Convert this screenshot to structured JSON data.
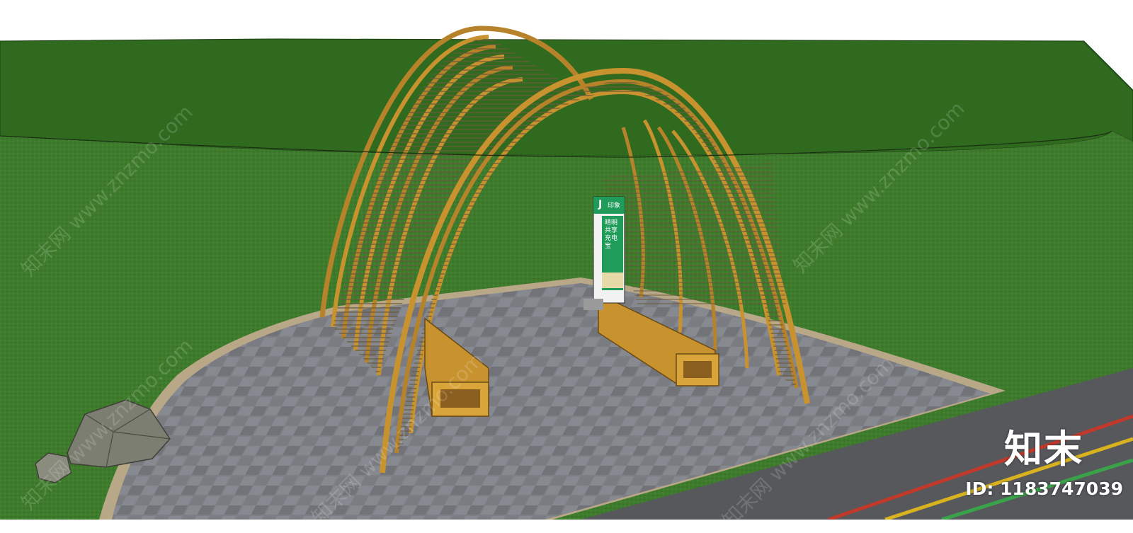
{
  "watermark": {
    "brand": "知末",
    "id_text": "ID: 1183747039",
    "site_text": "知末网 www.znzmo.com"
  },
  "sign": {
    "logo": "J",
    "header": "印象",
    "slogan": "晴明共享充电宝"
  },
  "colors": {
    "sky": "#ffffff",
    "grass": "#3f7d2e",
    "hill": "#2f6a1f",
    "pavement": "#7d7f84",
    "bamboo": "#c8922e",
    "road": "#57595d",
    "sign_green": "#1f9b5a"
  }
}
